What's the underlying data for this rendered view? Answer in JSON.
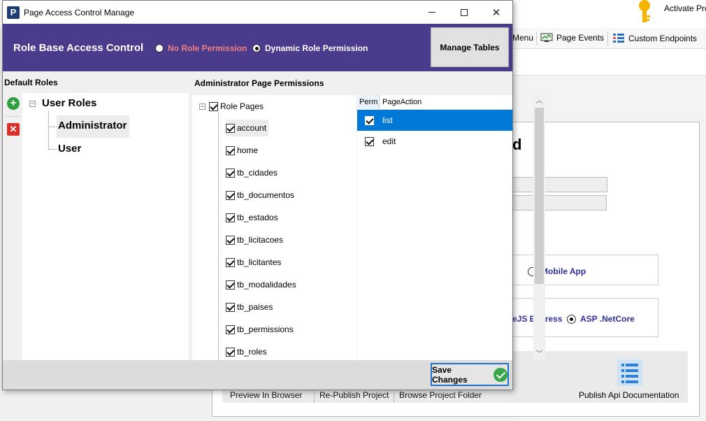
{
  "background_app": {
    "activate_text": "Activate Pro",
    "toolbar": [
      {
        "label": "Menu",
        "icon": "menu-icon"
      },
      {
        "label": "Page Events",
        "icon": "monitor-icon"
      },
      {
        "label": "Custom Endpoints",
        "icon": "list-icon"
      }
    ],
    "heading_partial": "d",
    "radio_mobile": "Mobile App",
    "radio_express": "eJS Express",
    "radio_aspnet": "ASP .NetCore",
    "bottom_buttons": [
      "Preview In Browser",
      "Re-Publish Project",
      "Browse Project Folder"
    ],
    "publish_doc": "Publish Api Documentation"
  },
  "dialog": {
    "title": "Page Access Control Manage",
    "icon_letter": "P",
    "header": {
      "title": "Role Base Access Control",
      "option_no_role": "No Role Permission",
      "option_dynamic": "Dynamic Role Permission",
      "selected": "dynamic",
      "manage_tables": "Manage Tables",
      "band_color": "#4b3b8c",
      "no_role_color": "#f08080"
    },
    "default_roles_label": "Default Roles",
    "role_tree": {
      "root": "User Roles",
      "children": [
        "Administrator",
        "User"
      ],
      "selected": "Administrator"
    },
    "permissions_label": "Administrator Page Permissions",
    "page_tree": {
      "root": "Role Pages",
      "items": [
        "account",
        "home",
        "tb_cidades",
        "tb_documentos",
        "tb_estados",
        "tb_licitacoes",
        "tb_licitantes",
        "tb_modalidades",
        "tb_paises",
        "tb_permissions",
        "tb_roles"
      ]
    },
    "action_grid": {
      "headers": [
        "Perm",
        "PageAction"
      ],
      "rows": [
        {
          "checked": true,
          "action": "list",
          "selected": true
        },
        {
          "checked": true,
          "action": "edit",
          "selected": false
        }
      ]
    },
    "save_changes": "Save Changes"
  }
}
